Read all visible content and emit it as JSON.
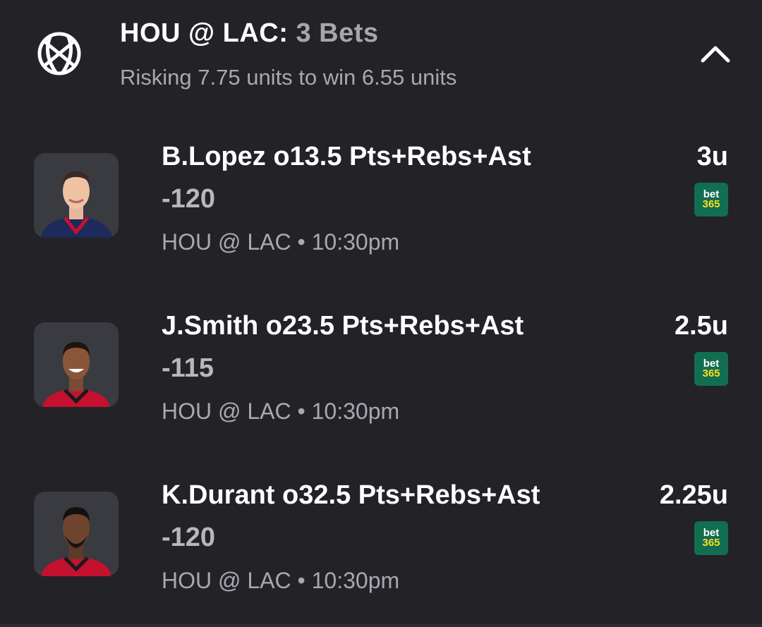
{
  "header": {
    "teams": "HOU @ LAC:",
    "bet_count": "3 Bets",
    "subtitle": "Risking 7.75 units to win 6.55 units",
    "sport_icon": "basketball-icon",
    "collapse_icon": "chevron-up-icon"
  },
  "bets": [
    {
      "title": "B.Lopez o13.5 Pts+Rebs+Ast",
      "odds": "-120",
      "meta": "HOU @ LAC • 10:30pm",
      "units": "3u",
      "book_top": "bet",
      "book_bottom": "365",
      "jersey_color": "#1d2a5c",
      "jersey_trim": "#c8102e"
    },
    {
      "title": "J.Smith o23.5 Pts+Rebs+Ast",
      "odds": "-115",
      "meta": "HOU @ LAC • 10:30pm",
      "units": "2.5u",
      "book_top": "bet",
      "book_bottom": "365",
      "jersey_color": "#c4112f",
      "jersey_trim": "#1a1a1a"
    },
    {
      "title": "K.Durant o32.5 Pts+Rebs+Ast",
      "odds": "-120",
      "meta": "HOU @ LAC • 10:30pm",
      "units": "2.25u",
      "book_top": "bet",
      "book_bottom": "365",
      "jersey_color": "#c4112f",
      "jersey_trim": "#1a1a1a"
    }
  ],
  "colors": {
    "background": "#222227",
    "muted_text": "#a8a8b0",
    "bet365_green": "#126e51",
    "bet365_yellow": "#ffdf1b"
  }
}
